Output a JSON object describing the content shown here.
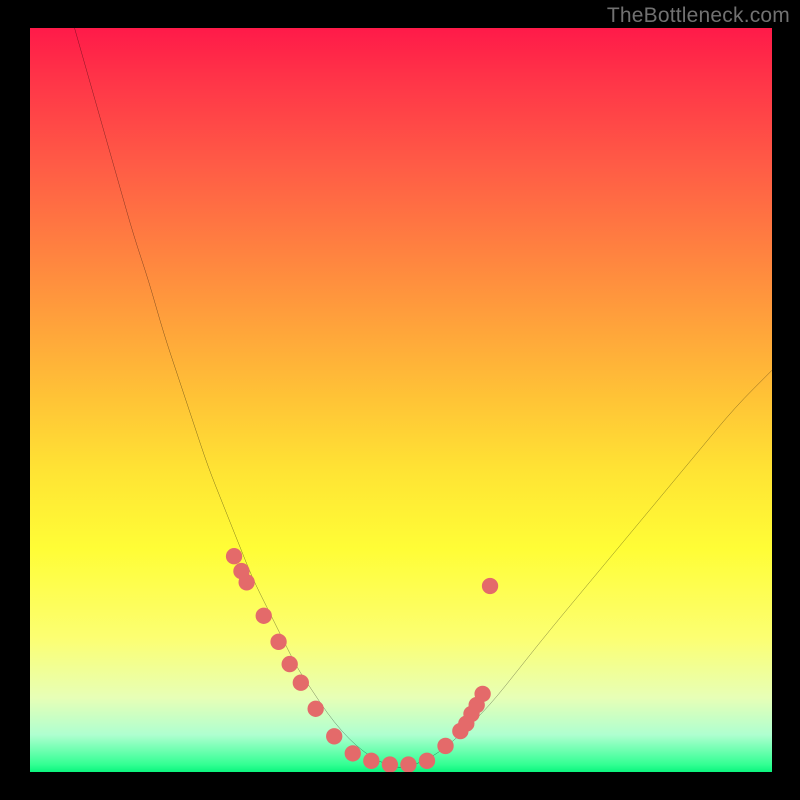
{
  "watermark": "TheBottleneck.com",
  "chart_data": {
    "type": "line",
    "title": "",
    "xlabel": "",
    "ylabel": "",
    "xlim": [
      0,
      100
    ],
    "ylim": [
      0,
      100
    ],
    "series": [
      {
        "name": "bottleneck-curve",
        "x": [
          6,
          8,
          10,
          12,
          14,
          16,
          18,
          20,
          22,
          24,
          26,
          28,
          30,
          32,
          34,
          36,
          38,
          40,
          42,
          44,
          46,
          48,
          50,
          52,
          55,
          58,
          62,
          66,
          70,
          75,
          80,
          85,
          90,
          95,
          100
        ],
        "values": [
          100,
          93,
          86,
          79,
          72,
          66,
          59,
          53,
          47,
          41,
          36,
          31,
          26,
          22,
          18,
          14,
          11,
          8,
          5.5,
          3.5,
          2,
          1,
          0.5,
          1,
          2.5,
          5,
          9,
          14,
          19,
          25,
          31,
          37,
          43,
          49,
          54
        ]
      }
    ],
    "markers": {
      "name": "highlight-points",
      "x": [
        27.5,
        28.5,
        29.2,
        31.5,
        33.5,
        35.0,
        36.5,
        38.5,
        41.0,
        43.5,
        46.0,
        48.5,
        51.0,
        53.5,
        56.0,
        58.0,
        58.8,
        59.5,
        60.2,
        61.0,
        62.0
      ],
      "values": [
        29.0,
        27.0,
        25.5,
        21.0,
        17.5,
        14.5,
        12.0,
        8.5,
        4.8,
        2.5,
        1.5,
        1.0,
        1.0,
        1.5,
        3.5,
        5.5,
        6.5,
        7.8,
        9.0,
        10.5,
        25.0
      ],
      "color": "#e46a6a",
      "radius": 1.1
    },
    "gradient_stops": [
      {
        "pos": 0,
        "color": "#ff1a49"
      },
      {
        "pos": 50,
        "color": "#ffc436"
      },
      {
        "pos": 70,
        "color": "#fffd36"
      },
      {
        "pos": 100,
        "color": "#0bf57e"
      }
    ]
  }
}
